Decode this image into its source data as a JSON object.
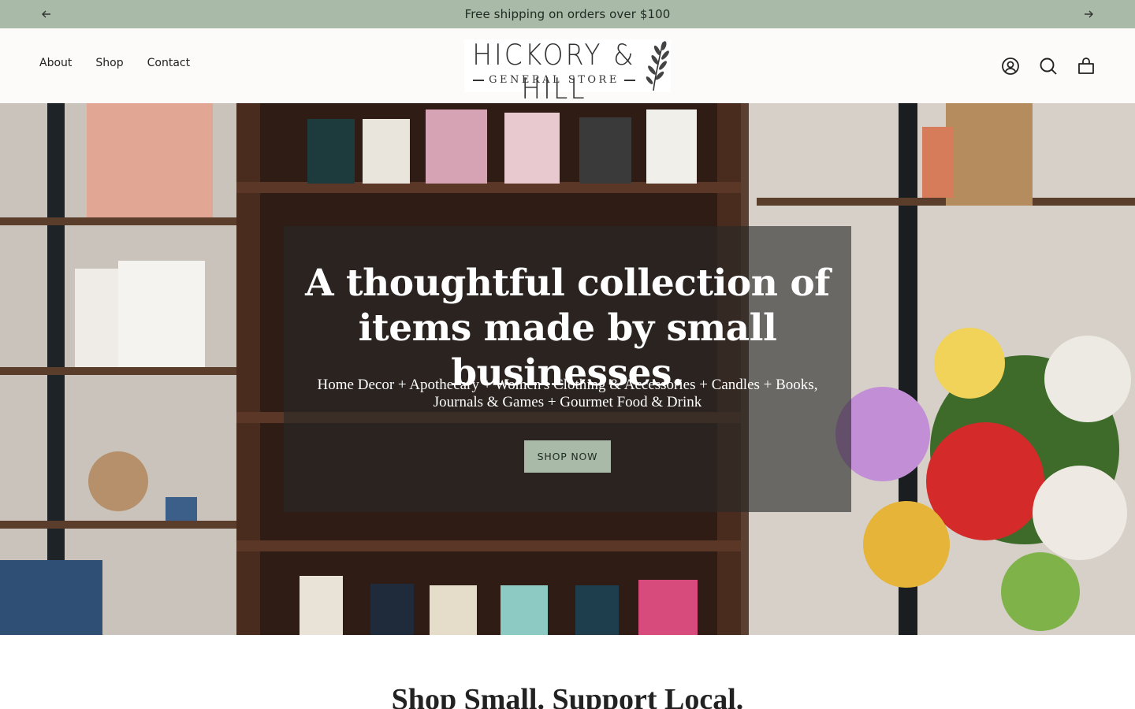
{
  "announcement": {
    "text": "Free shipping on orders over $100",
    "prev_icon": "arrow-left-icon",
    "next_icon": "arrow-right-icon",
    "background": "#a9bba8"
  },
  "nav": {
    "items": [
      {
        "label": "About"
      },
      {
        "label": "Shop"
      },
      {
        "label": "Contact"
      }
    ]
  },
  "logo": {
    "line1": "HICKORY & HILL",
    "line2": "GENERAL STORE",
    "icon": "leaf-sprig-icon"
  },
  "header_icons": [
    "account-icon",
    "search-icon",
    "cart-icon"
  ],
  "hero": {
    "title": "A thoughtful collection of items made by small businesses.",
    "subtitle": "Home Decor + Apothecary + Women's Clothing & Accessories + Candles + Books, Journals & Games + Gourmet Food & Drink",
    "cta": "SHOP NOW",
    "button_color": "#a9bba8"
  },
  "section": {
    "title": "Shop Small. Support Local."
  }
}
